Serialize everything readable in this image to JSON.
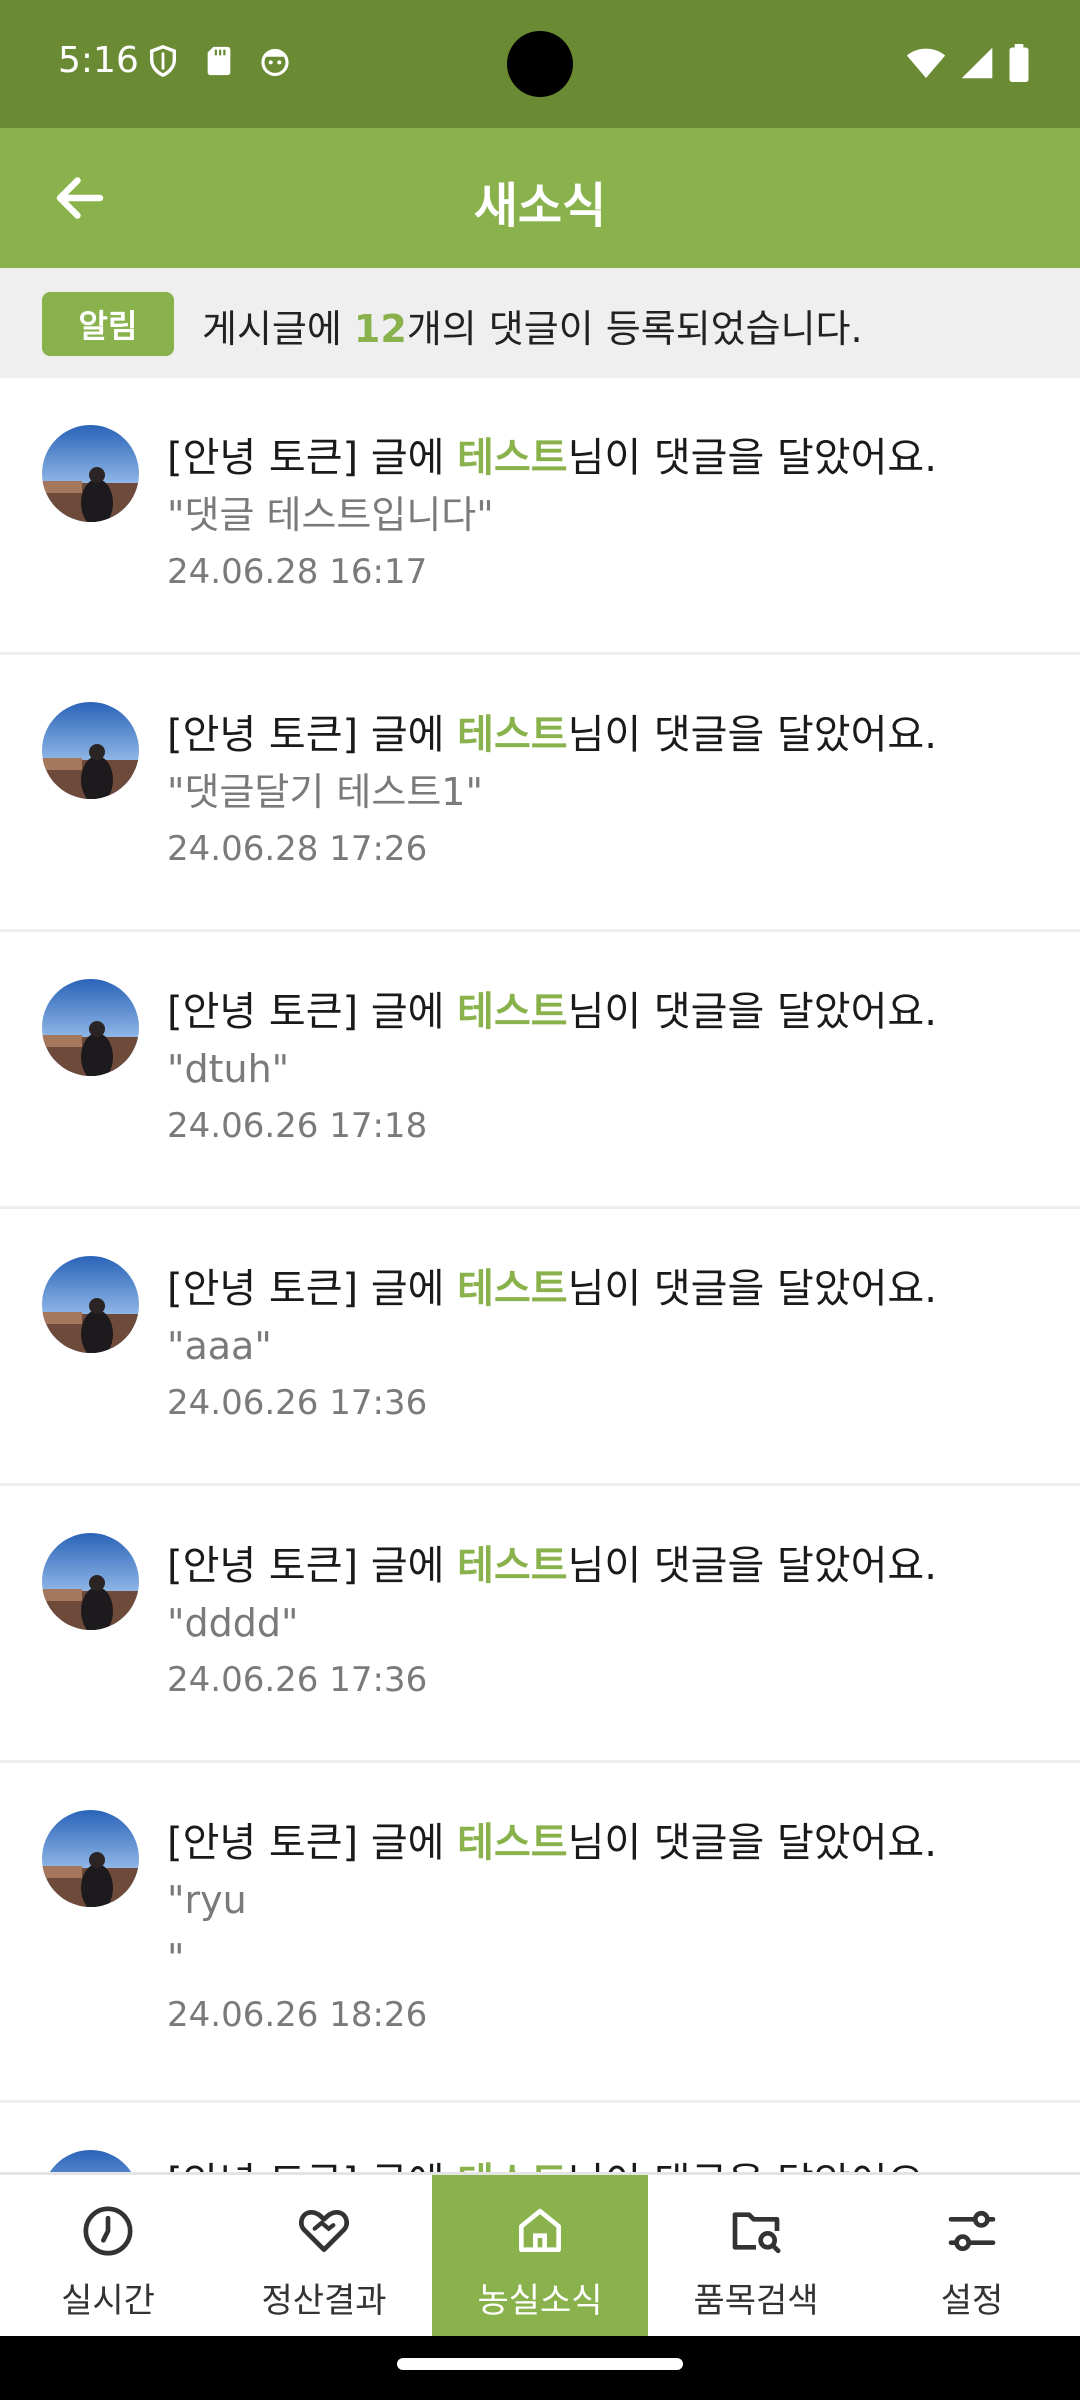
{
  "status_bar": {
    "time": "5:16",
    "left_icons": [
      "shield-icon",
      "sd-card-icon",
      "face-icon"
    ],
    "right_icons": [
      "wifi-icon",
      "cellular-signal-icon",
      "battery-icon"
    ]
  },
  "app_bar": {
    "title": "새소식",
    "back_icon": "arrow-left-icon"
  },
  "notice": {
    "badge": "알림",
    "text_before": "게시글에 ",
    "count": "12",
    "text_after": "개의 댓글이 등록되었습니다."
  },
  "notifications": [
    {
      "post": "[안녕 토큰] 글에 ",
      "author": "테스트",
      "suffix": "님이 댓글을 달았어요.",
      "comment": "\"댓글 테스트입니다\"",
      "date": "24.06.28 16:17"
    },
    {
      "post": "[안녕 토큰] 글에 ",
      "author": "테스트",
      "suffix": "님이 댓글을 달았어요.",
      "comment": "\"댓글달기 테스트1\"",
      "date": "24.06.28 17:26"
    },
    {
      "post": "[안녕 토큰] 글에 ",
      "author": "테스트",
      "suffix": "님이 댓글을 달았어요.",
      "comment": "\"dtuh\"",
      "date": "24.06.26 17:18"
    },
    {
      "post": "[안녕 토큰] 글에 ",
      "author": "테스트",
      "suffix": "님이 댓글을 달았어요.",
      "comment": "\"aaa\"",
      "date": "24.06.26 17:36"
    },
    {
      "post": "[안녕 토큰] 글에 ",
      "author": "테스트",
      "suffix": "님이 댓글을 달았어요.",
      "comment": "\"dddd\"",
      "date": "24.06.26 17:36"
    },
    {
      "post": "[안녕 토큰] 글에 ",
      "author": "테스트",
      "suffix": "님이 댓글을 달았어요.",
      "comment": "\"ryu\n\"",
      "date": "24.06.26 18:26"
    },
    {
      "post": "[안녕 토큰] 글에 ",
      "author": "테스트",
      "suffix": "님이 댓글을 달았어요.",
      "comment": "",
      "date": ""
    }
  ],
  "bottom_nav": [
    {
      "label": "실시간",
      "icon": "clock-icon",
      "active": false
    },
    {
      "label": "정산결과",
      "icon": "handshake-heart-icon",
      "active": false
    },
    {
      "label": "농실소식",
      "icon": "home-icon",
      "active": true
    },
    {
      "label": "품목검색",
      "icon": "folder-search-icon",
      "active": false
    },
    {
      "label": "설정",
      "icon": "sliders-icon",
      "active": false
    }
  ],
  "colors": {
    "status_bar": "#6a8a34",
    "accent": "#8ab24c",
    "notice_bg": "#efefef",
    "secondary_text": "#7a7a7a"
  }
}
